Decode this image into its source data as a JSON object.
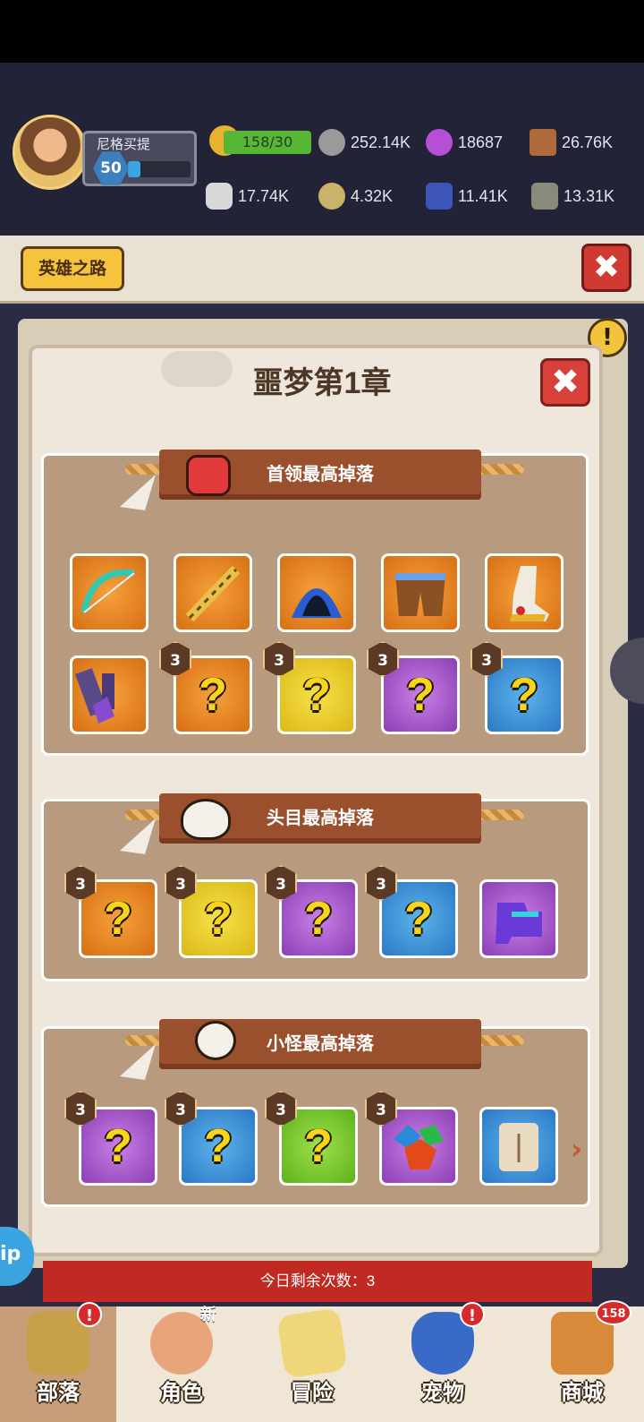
{
  "player": {
    "name": "尼格买提",
    "level": "50",
    "xp_fraction": 0.2
  },
  "resources": {
    "energy": "158/30",
    "stone": "252.14K",
    "crystal": "18687",
    "wood": "26.76K",
    "bone": "17.74K",
    "ore": "4.32K",
    "gem": "11.41K",
    "iron": "13.31K"
  },
  "header": {
    "hero_road_label": "英雄之路"
  },
  "dialog": {
    "title": "噩梦第1章",
    "close_icon": "close-icon",
    "sections": [
      {
        "title": "首领最高掉落",
        "icon": "red-dragon-icon",
        "row1": [
          {
            "rarity": "orange",
            "item": "jade-bow"
          },
          {
            "rarity": "orange",
            "item": "golden-staff"
          },
          {
            "rarity": "orange",
            "item": "blue-hood"
          },
          {
            "rarity": "orange",
            "item": "leather-shorts"
          },
          {
            "rarity": "orange",
            "item": "golden-boot"
          }
        ],
        "row2": [
          {
            "rarity": "orange",
            "item": "dark-shards"
          },
          {
            "rarity": "orange",
            "item": "mystery",
            "badge": "3"
          },
          {
            "rarity": "yellow",
            "item": "mystery",
            "badge": "3"
          },
          {
            "rarity": "purple",
            "item": "mystery",
            "badge": "3"
          },
          {
            "rarity": "blue",
            "item": "mystery",
            "badge": "3"
          }
        ]
      },
      {
        "title": "头目最高掉落",
        "icon": "horned-skull-icon",
        "row1": [
          {
            "rarity": "orange",
            "item": "mystery",
            "badge": "3"
          },
          {
            "rarity": "yellow",
            "item": "mystery",
            "badge": "3"
          },
          {
            "rarity": "purple",
            "item": "mystery",
            "badge": "3"
          },
          {
            "rarity": "blue",
            "item": "mystery",
            "badge": "3"
          },
          {
            "rarity": "purple",
            "item": "purple-gauntlet"
          }
        ]
      },
      {
        "title": "小怪最高掉落",
        "icon": "skull-icon",
        "row1": [
          {
            "rarity": "purple",
            "item": "mystery",
            "badge": "3"
          },
          {
            "rarity": "blue",
            "item": "mystery",
            "badge": "3"
          },
          {
            "rarity": "green",
            "item": "mystery",
            "badge": "3"
          },
          {
            "rarity": "purple",
            "item": "gem-cluster",
            "badge": "3"
          },
          {
            "rarity": "blue",
            "item": "scroll"
          }
        ]
      }
    ],
    "mystery_mark": "?"
  },
  "remaining": "今日剩余次数：3",
  "side_label": "ip",
  "nav": [
    {
      "label": "部落",
      "badge": "!"
    },
    {
      "label": "角色",
      "badge": "新"
    },
    {
      "label": "冒险",
      "badge": ""
    },
    {
      "label": "宠物",
      "badge": "!"
    },
    {
      "label": "商城",
      "badge": "158"
    }
  ],
  "colors": {
    "accent": "#9a4f2d",
    "close": "#d8403a",
    "energy": "#58b636"
  }
}
